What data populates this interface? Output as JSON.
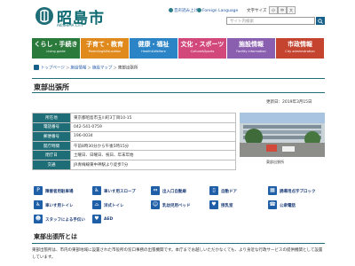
{
  "header": {
    "logo_text": "昭島市",
    "logo_sub": "AKISHIMA CITY",
    "link_sitemap": "音声読み上げ",
    "link_lang": "Foreign Language",
    "textsize_label": "文字サイズ",
    "textsize_small": "小",
    "textsize_medium": "中",
    "textsize_large": "大",
    "search_placeholder": "サイト内検索"
  },
  "nav": [
    {
      "label": "くらし・手続き",
      "sub": "Living guide",
      "color": "#2a7a3c"
    },
    {
      "label": "子育て・教育",
      "sub": "Parenting&Education",
      "color": "#e08a1e"
    },
    {
      "label": "健康・福祉",
      "sub": "Health&Welfare",
      "color": "#2b84c6"
    },
    {
      "label": "文化・スポーツ",
      "sub": "Culture&Sports",
      "color": "#d2487a"
    },
    {
      "label": "施設情報",
      "sub": "Facility information",
      "color": "#8a5fb0"
    },
    {
      "label": "市政情報",
      "sub": "City administration",
      "color": "#c4442f"
    }
  ],
  "breadcrumb": [
    "トップページ",
    "施設情報",
    "施設マップ",
    "東部出張所"
  ],
  "page_title": "東部出張所",
  "updated": "更新日：2019年3月15日",
  "info_rows": [
    {
      "label": "所在地",
      "value": "東京都昭島市玉川町3丁目10-15"
    },
    {
      "label": "電話番号",
      "value": "042-541-0759"
    },
    {
      "label": "郵便番号",
      "value": "196-0034"
    },
    {
      "label": "開庁時間",
      "value": "午前8時30分から午後5時15分"
    },
    {
      "label": "閉庁日",
      "value": "土曜日、日曜日、祝日、年末年始"
    },
    {
      "label": "交通",
      "value": "JR青梅線東中神駅より徒歩7分"
    }
  ],
  "photo_caption": "東部出張所",
  "facilities": [
    {
      "label": "障害者用駐車場",
      "icon": "wheelchair-parking-icon",
      "glyph": "P"
    },
    {
      "label": "車いす用スロープ",
      "icon": "slope-icon",
      "glyph": "♿"
    },
    {
      "label": "出入口自動扉",
      "icon": "auto-door-icon",
      "glyph": "⇔"
    },
    {
      "label": "自動ドア",
      "icon": "door-icon",
      "glyph": "▯"
    },
    {
      "label": "誘導用点字ブロック",
      "icon": "braille-block-icon",
      "glyph": "▦"
    },
    {
      "label": "車いす用トイレ",
      "icon": "accessible-toilet-icon",
      "glyph": "♿"
    },
    {
      "label": "洋式トイレ",
      "icon": "western-toilet-icon",
      "glyph": "⌓"
    },
    {
      "label": "乳幼児用ベッド",
      "icon": "baby-bed-icon",
      "glyph": "☺"
    },
    {
      "label": "授乳室",
      "icon": "nursing-room-icon",
      "glyph": "♥"
    },
    {
      "label": "公衆電話",
      "icon": "phone-icon",
      "glyph": "☎"
    },
    {
      "label": "スタッフによる手伝い",
      "icon": "staff-icon",
      "glyph": "☻"
    },
    {
      "label": "AED",
      "icon": "aed-icon",
      "glyph": "♥"
    }
  ],
  "section_title": "東部出張所とは",
  "section_body": "東部出張所は、市内の東部地域に設置された市役所の窓口事務の出張機関です。本庁までお越しいただかなくても、より身近な行政サービスの提供機関として設置しています。"
}
